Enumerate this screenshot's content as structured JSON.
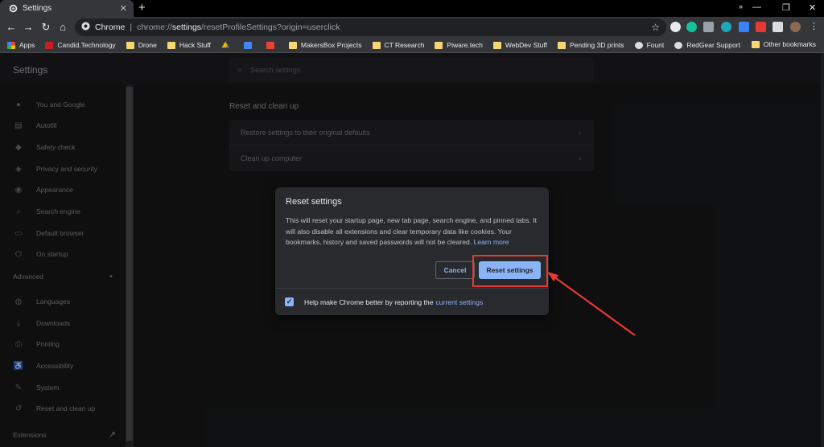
{
  "tab": {
    "title": "Settings",
    "close": "✕",
    "newtab": "+"
  },
  "window_controls": {
    "minimize": "—",
    "restore": "❐",
    "close": "✕"
  },
  "toolbar": {
    "back": "←",
    "forward": "→",
    "reload": "↻",
    "home": "⌂",
    "site_chip": "Chrome",
    "url_prefix": "chrome://",
    "url_host": "settings",
    "url_path": "/resetProfileSettings?origin=userclick",
    "star": "☆"
  },
  "bookmarks": {
    "items": [
      {
        "label": "Apps",
        "kind": "apps"
      },
      {
        "label": "Candid.Technology",
        "kind": "site"
      },
      {
        "label": "Drone",
        "kind": "folder"
      },
      {
        "label": "Hack Stuff",
        "kind": "folder"
      },
      {
        "label": "",
        "kind": "drive"
      },
      {
        "label": "",
        "kind": "doc"
      },
      {
        "label": "",
        "kind": "gmail"
      },
      {
        "label": "MakersBox Projects",
        "kind": "folder"
      },
      {
        "label": "CT Research",
        "kind": "folder"
      },
      {
        "label": "Piware.tech",
        "kind": "folder"
      },
      {
        "label": "WebDev Stuff",
        "kind": "folder"
      },
      {
        "label": "Pending 3D prints",
        "kind": "folder"
      },
      {
        "label": "Fount",
        "kind": "globe"
      },
      {
        "label": "RedGear Support",
        "kind": "globe"
      }
    ],
    "overflow": "»",
    "other": "Other bookmarks"
  },
  "settings": {
    "title": "Settings",
    "search_placeholder": "Search settings",
    "nav": [
      {
        "label": "You and Google",
        "icon": "person-icon",
        "glyph": "●"
      },
      {
        "label": "Autofill",
        "icon": "clipboard-icon",
        "glyph": "▤"
      },
      {
        "label": "Safety check",
        "icon": "shield-check-icon",
        "glyph": "◆"
      },
      {
        "label": "Privacy and security",
        "icon": "shield-icon",
        "glyph": "◈"
      },
      {
        "label": "Appearance",
        "icon": "palette-icon",
        "glyph": "◉"
      },
      {
        "label": "Search engine",
        "icon": "search-icon",
        "glyph": "⌕"
      },
      {
        "label": "Default browser",
        "icon": "browser-icon",
        "glyph": "▭"
      },
      {
        "label": "On startup",
        "icon": "power-icon",
        "glyph": "⏻"
      }
    ],
    "advanced_label": "Advanced",
    "advanced_chevron": "▲",
    "advanced_nav": [
      {
        "label": "Languages",
        "icon": "globe-icon",
        "glyph": "◍"
      },
      {
        "label": "Downloads",
        "icon": "download-icon",
        "glyph": "⤓"
      },
      {
        "label": "Printing",
        "icon": "printer-icon",
        "glyph": "⎙"
      },
      {
        "label": "Accessibility",
        "icon": "accessibility-icon",
        "glyph": "♿"
      },
      {
        "label": "System",
        "icon": "wrench-icon",
        "glyph": "✎"
      },
      {
        "label": "Reset and clean up",
        "icon": "history-icon",
        "glyph": "↺"
      }
    ],
    "extensions_label": "Extensions",
    "extensions_icon": "↗",
    "section_title": "Reset and clean up",
    "rows": [
      {
        "label": "Restore settings to their original defaults",
        "chevron": "›"
      },
      {
        "label": "Clean up computer",
        "chevron": "›"
      }
    ]
  },
  "dialog": {
    "title": "Reset settings",
    "body": "This will reset your startup page, new tab page, search engine, and pinned tabs. It will also disable all extensions and clear temporary data like cookies. Your bookmarks, history and saved passwords will not be cleared.",
    "learn_more": "Learn more",
    "cancel": "Cancel",
    "reset": "Reset settings",
    "checkbox_label": "Help make Chrome better by reporting the",
    "checkbox_link": "current settings",
    "checkbox_mark": "✓"
  },
  "colors": {
    "annotation": "#e53935",
    "accent": "#8ab4f8"
  }
}
